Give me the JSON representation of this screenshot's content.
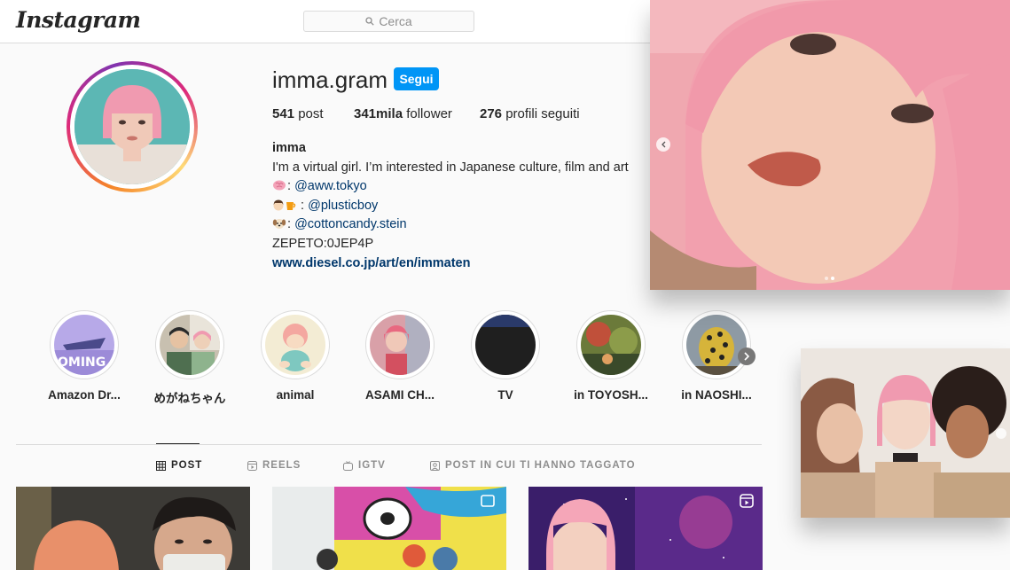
{
  "nav": {
    "logo": "Instagram",
    "search_placeholder": "Cerca"
  },
  "profile": {
    "username": "imma.gram",
    "follow_label": "Segui",
    "stats": [
      {
        "value": "541",
        "label": " post"
      },
      {
        "value": "341mila",
        "label": " follower"
      },
      {
        "value": "276",
        "label": " profili seguiti"
      }
    ],
    "bio": {
      "name": "imma",
      "line1": "I'm a virtual girl. I’m interested in Japanese culture, film and art",
      "line2_prefix": ": ",
      "line2_mention": "@aww.tokyo",
      "line3_prefix": " : ",
      "line3_mention": "@plusticboy",
      "line4_prefix": ": ",
      "line4_mention": "@cottoncandy.stein",
      "line5": "ZEPETO:0JEP4P",
      "website": "www.diesel.co.jp/art/en/immaten"
    }
  },
  "highlights": [
    {
      "label": "Amazon Dr..."
    },
    {
      "label": "めがねちゃん"
    },
    {
      "label": "animal"
    },
    {
      "label": "ASAMI CH..."
    },
    {
      "label": "TV"
    },
    {
      "label": "in TOYOSH..."
    },
    {
      "label": "in NAOSHI..."
    }
  ],
  "tabs": [
    {
      "label": "POST",
      "icon": "grid-icon",
      "active": true
    },
    {
      "label": "REELS",
      "icon": "reels-icon",
      "active": false
    },
    {
      "label": "IGTV",
      "icon": "igtv-icon",
      "active": false
    },
    {
      "label": "POST IN CUI TI HANNO TAGGATO",
      "icon": "tagged-icon",
      "active": false
    }
  ],
  "colors": {
    "primary_blue": "#0095f6",
    "link_blue": "#00376b",
    "text": "#262626",
    "muted": "#8e8e8e",
    "border": "#dbdbdb"
  }
}
